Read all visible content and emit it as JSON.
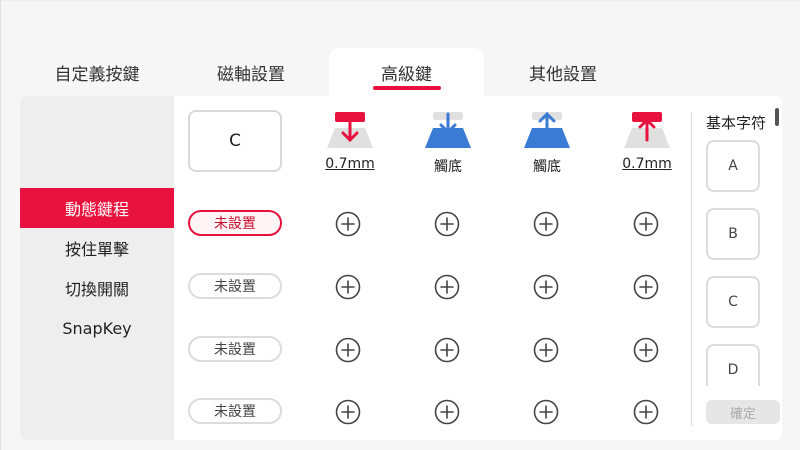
{
  "tabs": [
    {
      "label": "自定義按鍵"
    },
    {
      "label": "磁軸設置"
    },
    {
      "label": "高級鍵"
    },
    {
      "label": "其他設置"
    }
  ],
  "sidebar": {
    "items": [
      {
        "label": "動態鍵程"
      },
      {
        "label": "按住單擊"
      },
      {
        "label": "切換開關"
      },
      {
        "label": "SnapKey"
      }
    ]
  },
  "key": {
    "label": "C"
  },
  "headers": [
    {
      "label": "0.7mm",
      "icon": "press-down-red",
      "color": "#e8123f"
    },
    {
      "label": "觸底",
      "icon": "bottom-out-blue",
      "color": "#3a7bd5"
    },
    {
      "label": "觸底",
      "icon": "release-up-blue",
      "color": "#3a7bd5"
    },
    {
      "label": "0.7mm",
      "icon": "release-up-red",
      "color": "#e8123f"
    }
  ],
  "rows": [
    {
      "label": "未設置"
    },
    {
      "label": "未設置"
    },
    {
      "label": "未設置"
    },
    {
      "label": "未設置"
    }
  ],
  "right": {
    "title": "基本字符",
    "keys": [
      "A",
      "B",
      "C",
      "D"
    ],
    "confirm": "確定"
  },
  "colors": {
    "accent": "#e8123f",
    "blue": "#3a7bd5"
  }
}
